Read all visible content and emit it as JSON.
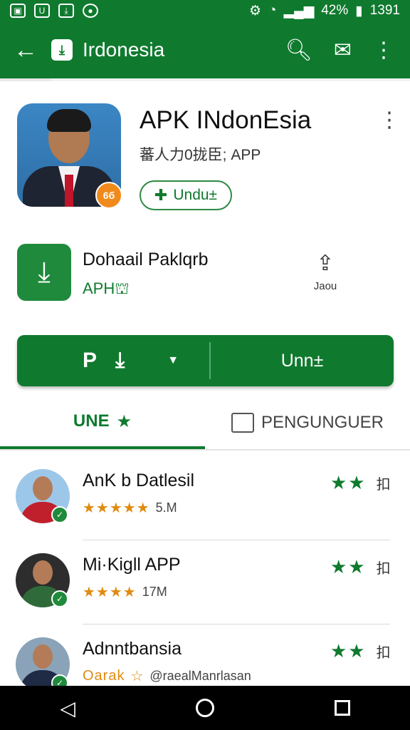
{
  "status_bar": {
    "time": "1391",
    "battery": "42%"
  },
  "app_bar": {
    "title": "Irdonesia"
  },
  "header": {
    "title": "APK INdonEsia",
    "subtitle": "蕃人力0拢臣; APP",
    "install_label": "Undu±",
    "badge": "6б"
  },
  "download_row": {
    "title": "Dohaail Paklqrb",
    "subtitle": "APH",
    "share_label": "Jaou"
  },
  "main_button": {
    "left_label": "P",
    "right_label": "Unn±"
  },
  "tabs": [
    {
      "label": "UNE"
    },
    {
      "label": "PENGUNGUER"
    }
  ],
  "list": [
    {
      "name": "AnK b Datlesil",
      "rating": "5.M",
      "tag": "扣"
    },
    {
      "name": "Mi·Kigll APP",
      "rating": "17M",
      "tag": "扣"
    },
    {
      "name": "Adnntbansia",
      "rating": "@raealManrlasan",
      "rating_prefix": "Oarak",
      "tag": "扣"
    }
  ],
  "colors": {
    "primary": "#0f7a2e",
    "star": "#e08b10"
  }
}
